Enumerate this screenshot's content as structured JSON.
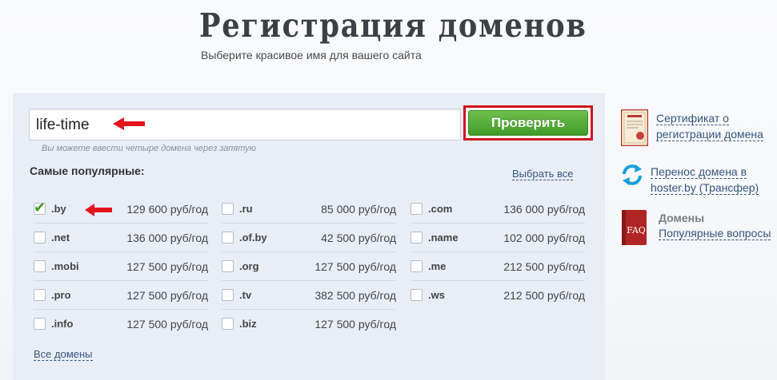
{
  "header": {
    "title": "Регистрация доменов",
    "subtitle": "Выберите красивое имя для вашего сайта"
  },
  "search": {
    "value": "life-time",
    "placeholder": "",
    "button_label": "Проверить",
    "hint": "Вы можете ввести четыре домена через запятую"
  },
  "popular": {
    "title": "Самые популярные:",
    "select_all": "Выбрать все",
    "all_domains": "Все домены",
    "columns": [
      [
        {
          "name": ".by",
          "price": "129 600 руб/год",
          "checked": true
        },
        {
          "name": ".net",
          "price": "136 000 руб/год",
          "checked": false
        },
        {
          "name": ".mobi",
          "price": "127 500 руб/год",
          "checked": false
        },
        {
          "name": ".pro",
          "price": "127 500 руб/год",
          "checked": false
        },
        {
          "name": ".info",
          "price": "127 500 руб/год",
          "checked": false
        }
      ],
      [
        {
          "name": ".ru",
          "price": "85 000 руб/год",
          "checked": false
        },
        {
          "name": ".of.by",
          "price": "42 500 руб/год",
          "checked": false
        },
        {
          "name": ".org",
          "price": "127 500 руб/год",
          "checked": false
        },
        {
          "name": ".tv",
          "price": "382 500 руб/год",
          "checked": false
        },
        {
          "name": ".biz",
          "price": "127 500 руб/год",
          "checked": false
        }
      ],
      [
        {
          "name": ".com",
          "price": "136 000 руб/год",
          "checked": false
        },
        {
          "name": ".name",
          "price": "102 000 руб/год",
          "checked": false
        },
        {
          "name": ".me",
          "price": "212 500 руб/год",
          "checked": false
        },
        {
          "name": ".ws",
          "price": "212 500 руб/год",
          "checked": false
        }
      ]
    ]
  },
  "sidebar": {
    "certificate": {
      "line1": "Сертификат о",
      "line2": "регистрации домена",
      "icon": "certificate-icon"
    },
    "transfer": {
      "line1": "Перенос домена в",
      "line2": "hoster.by (Трансфер)",
      "icon": "refresh-icon"
    },
    "faq": {
      "heading": "Домены",
      "link": "Популярные вопросы",
      "icon": "faq-book-icon",
      "icon_text": "FAQ"
    }
  },
  "colors": {
    "accent_green": "#4caf33",
    "highlight_red": "#d0121c",
    "link_blue": "#35557e",
    "panel_bg": "#e9eef6"
  }
}
